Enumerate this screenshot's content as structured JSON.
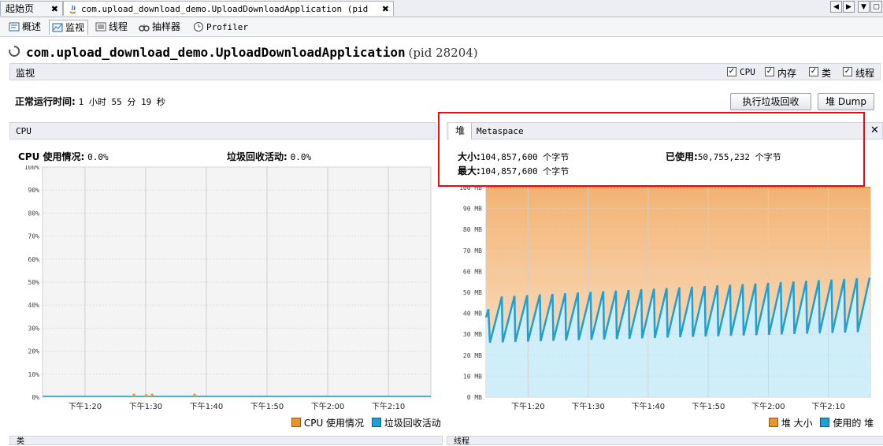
{
  "tabs": {
    "start_page": "起始页",
    "app_tab": "com.upload_download_demo.UploadDownloadApplication (pid 28204)",
    "close": "✖"
  },
  "subtabs": [
    "概述",
    "监视",
    "线程",
    "抽样器",
    "Profiler"
  ],
  "title": {
    "app_name": "com.upload_download_demo.UploadDownloadApplication",
    "pid": "(pid 28204)"
  },
  "monitor_bar": {
    "label": "监视",
    "checks": [
      "CPU",
      "内存",
      "类",
      "线程"
    ]
  },
  "uptime": {
    "label": "正常运行时间:",
    "value": "1 小时 55 分 19 秒"
  },
  "buttons": {
    "gc": "执行垃圾回收",
    "heap_dump": "堆 Dump"
  },
  "cpu_panel": {
    "header": "CPU",
    "usage_label": "CPU 使用情况:",
    "usage_value": "0.0%",
    "gc_label": "垃圾回收活动:",
    "gc_value": "0.0%",
    "legend": [
      "CPU 使用情况",
      "垃圾回收活动"
    ]
  },
  "heap_panel": {
    "tabs": [
      "堆",
      "Metaspace"
    ],
    "size_label": "大小:",
    "size_value": "104,857,600 个字节",
    "max_label": "最大:",
    "max_value": "104,857,600 个字节",
    "used_label": "已使用:",
    "used_value": "50,755,232 个字节",
    "legend": [
      "堆 大小",
      "使用的 堆"
    ]
  },
  "bottom_panels": [
    "类",
    "线程"
  ],
  "colors": {
    "cpu_series": "#e8962c",
    "gc_series": "#1ea0d2",
    "heap_size": "#f2b373",
    "heap_used_line": "#1ea0d2",
    "heap_used_fill": "#cfeefa",
    "highlight_box": "#e01010"
  },
  "chart_data": [
    {
      "type": "line",
      "title": "CPU",
      "ylim": [
        0,
        100
      ],
      "yticks": [
        "0%",
        "10%",
        "20%",
        "30%",
        "40%",
        "50%",
        "60%",
        "70%",
        "80%",
        "90%",
        "100%"
      ],
      "xticks": [
        "下午1:20",
        "下午1:30",
        "下午1:40",
        "下午1:50",
        "下午2:00",
        "下午2:10"
      ],
      "series": [
        {
          "name": "CPU 使用情况",
          "spikes_at_minutes": [
            15,
            17,
            18,
            25,
            69
          ],
          "values": [
            1,
            0.8,
            1,
            1,
            1
          ]
        },
        {
          "name": "垃圾回收活动",
          "values": [
            0,
            0,
            0,
            0,
            0,
            0
          ]
        }
      ],
      "grid": true
    },
    {
      "type": "area",
      "title": "堆",
      "ylim": [
        0,
        100
      ],
      "yticks": [
        "0 MB",
        "10 MB",
        "20 MB",
        "30 MB",
        "40 MB",
        "50 MB",
        "60 MB",
        "70 MB",
        "80 MB",
        "90 MB",
        "100 MB"
      ],
      "xticks": [
        "下午1:20",
        "下午1:30",
        "下午1:40",
        "下午1:50",
        "下午2:00",
        "下午2:10"
      ],
      "series": [
        {
          "name": "堆 大小",
          "values": [
            100,
            100
          ]
        },
        {
          "name": "使用的 堆",
          "sawtooth": {
            "cycles": 30,
            "min_start": 26,
            "min_end": 31,
            "max_start": 48,
            "max_end": 57
          }
        }
      ],
      "grid": true
    }
  ]
}
